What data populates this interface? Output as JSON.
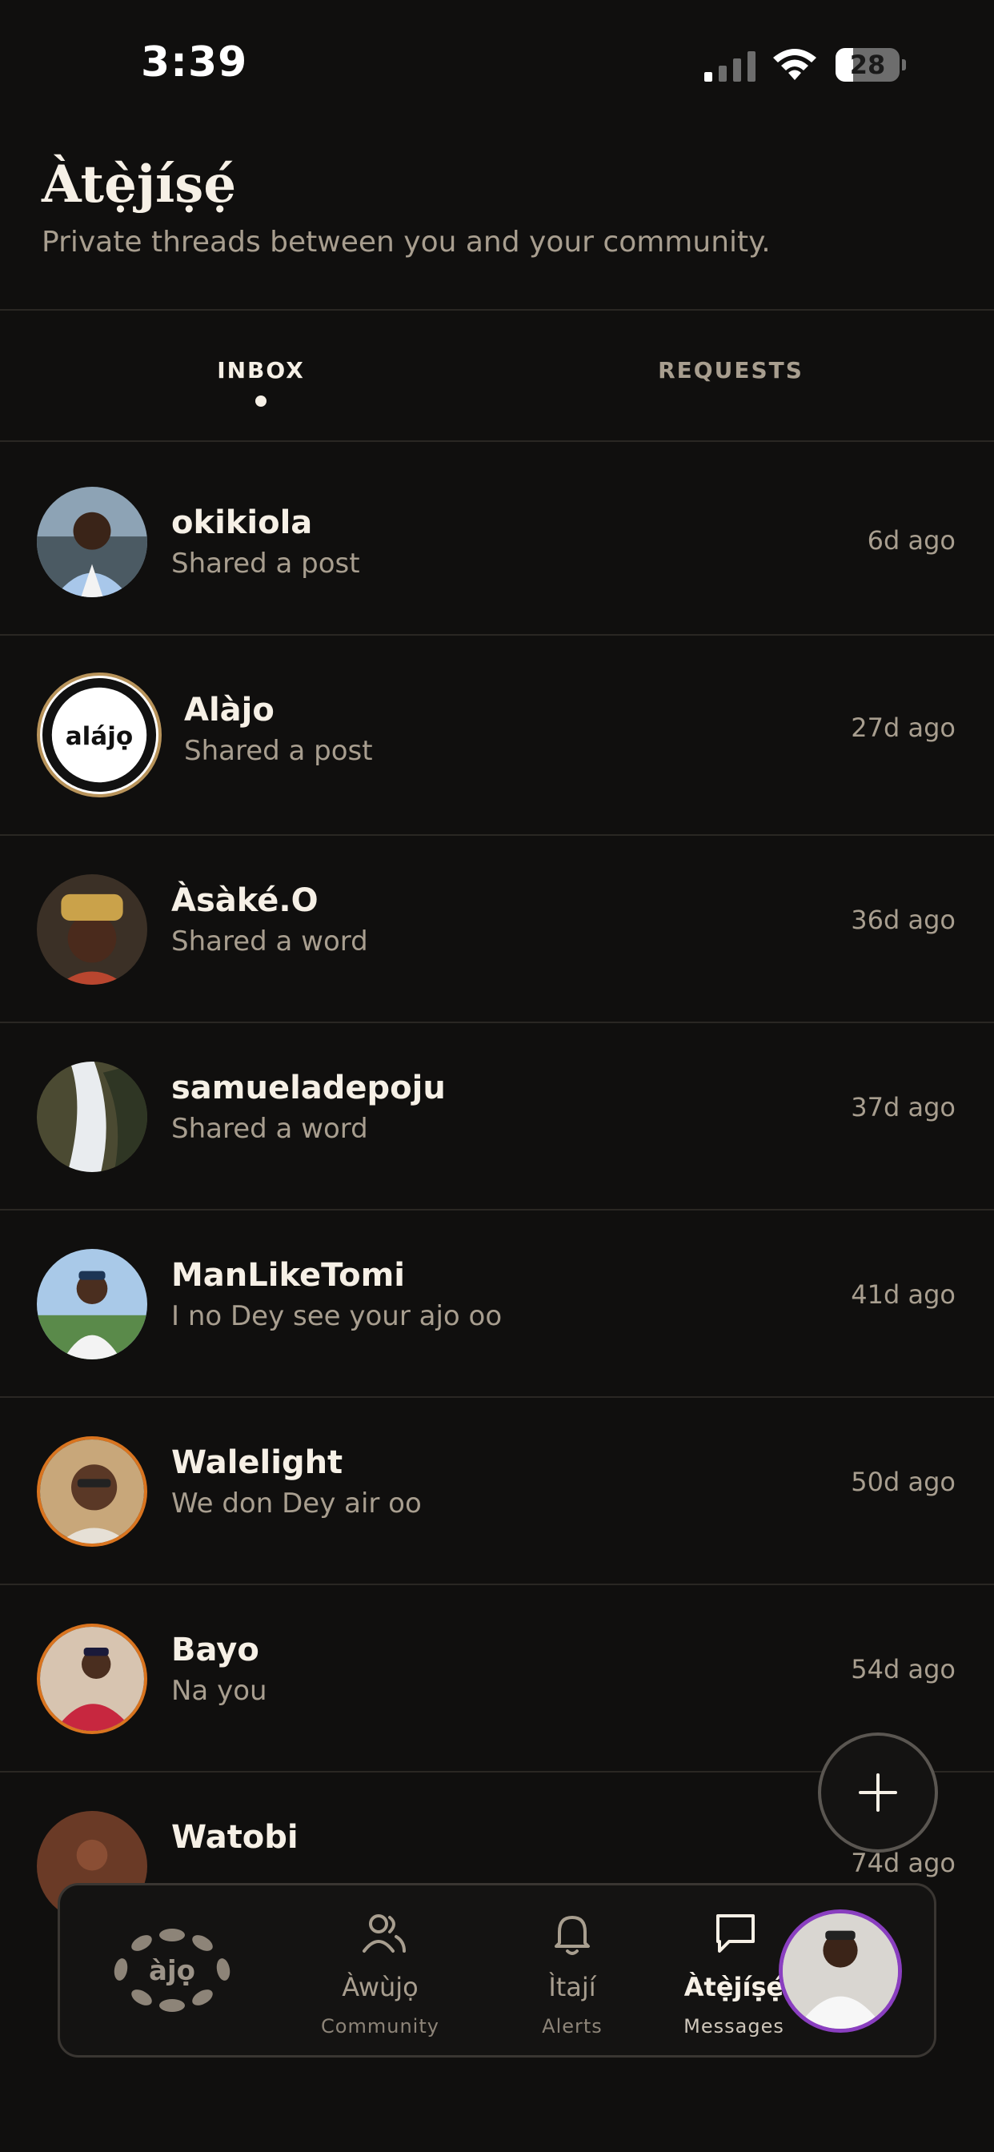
{
  "status_bar": {
    "time": "3:39",
    "battery": "28",
    "battery_level": 0.28
  },
  "header": {
    "title": "Àtẹ̀jíṣẹ́",
    "subtitle": "Private threads between you and your community."
  },
  "tabs": [
    {
      "label": "INBOX",
      "active": true
    },
    {
      "label": "REQUESTS",
      "active": false
    }
  ],
  "threads": [
    {
      "name": "okikiola",
      "preview": "Shared a post",
      "time": "6d ago"
    },
    {
      "name": "Alàjo",
      "preview": "Shared a post",
      "time": "27d ago",
      "logo_text": "alájọ"
    },
    {
      "name": "Àsàké.O",
      "preview": "Shared a word",
      "time": "36d ago"
    },
    {
      "name": "samueladepoju",
      "preview": "Shared a word",
      "time": "37d ago"
    },
    {
      "name": "ManLikeTomi",
      "preview": "I no Dey see your ajo oo",
      "time": "41d ago"
    },
    {
      "name": "Walelight",
      "preview": "We don Dey air oo",
      "time": "50d ago"
    },
    {
      "name": "Bayo",
      "preview": "Na you",
      "time": "54d ago"
    },
    {
      "name": "Watobi",
      "preview": "",
      "time": "74d ago"
    }
  ],
  "fab": {
    "icon": "plus-icon"
  },
  "nav": {
    "logo_text": "àjọ",
    "items": [
      {
        "label": "Àwùjọ",
        "sub": "Community",
        "icon": "people-icon",
        "active": false
      },
      {
        "label": "Ìtají",
        "sub": "Alerts",
        "icon": "bell-icon",
        "active": false
      },
      {
        "label": "Àtẹ̀jíṣẹ́",
        "sub": "Messages",
        "icon": "chat-bubble-icon",
        "active": true
      }
    ]
  },
  "colors": {
    "background": "#100f0e",
    "text_primary": "#f6f0e6",
    "text_secondary": "#a89e8f",
    "avatar_ring_orange": "#d9741f",
    "profile_ring_purple": "#8a3fc0"
  }
}
